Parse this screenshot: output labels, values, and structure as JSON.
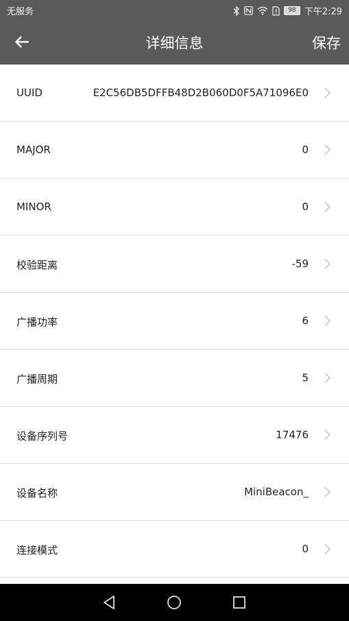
{
  "status_bar": {
    "carrier": "无服务",
    "battery": "98",
    "time": "下午2:29",
    "icons": [
      "bluetooth-icon",
      "nfc-icon",
      "wifi-icon",
      "sim-icon",
      "battery-icon"
    ]
  },
  "header": {
    "title": "详细信息",
    "save_label": "保存",
    "back_icon": "arrow-left-icon"
  },
  "fields": [
    {
      "label": "UUID",
      "value": "E2C56DB5DFFB48D2B060D0F5A71096E0"
    },
    {
      "label": "MAJOR",
      "value": "0"
    },
    {
      "label": "MINOR",
      "value": "0"
    },
    {
      "label": "校验距离",
      "value": "-59"
    },
    {
      "label": "广播功率",
      "value": "6"
    },
    {
      "label": "广播周期",
      "value": "5"
    },
    {
      "label": "设备序列号",
      "value": "17476"
    },
    {
      "label": "设备名称",
      "value": "MiniBeacon_"
    },
    {
      "label": "连接模式",
      "value": "0"
    }
  ],
  "nav": [
    "back-triangle-icon",
    "home-circle-icon",
    "recents-square-icon"
  ],
  "colors": {
    "bar": "#5a5a5a",
    "divider": "#dcdcdc",
    "chevron": "#c8c8c8"
  }
}
